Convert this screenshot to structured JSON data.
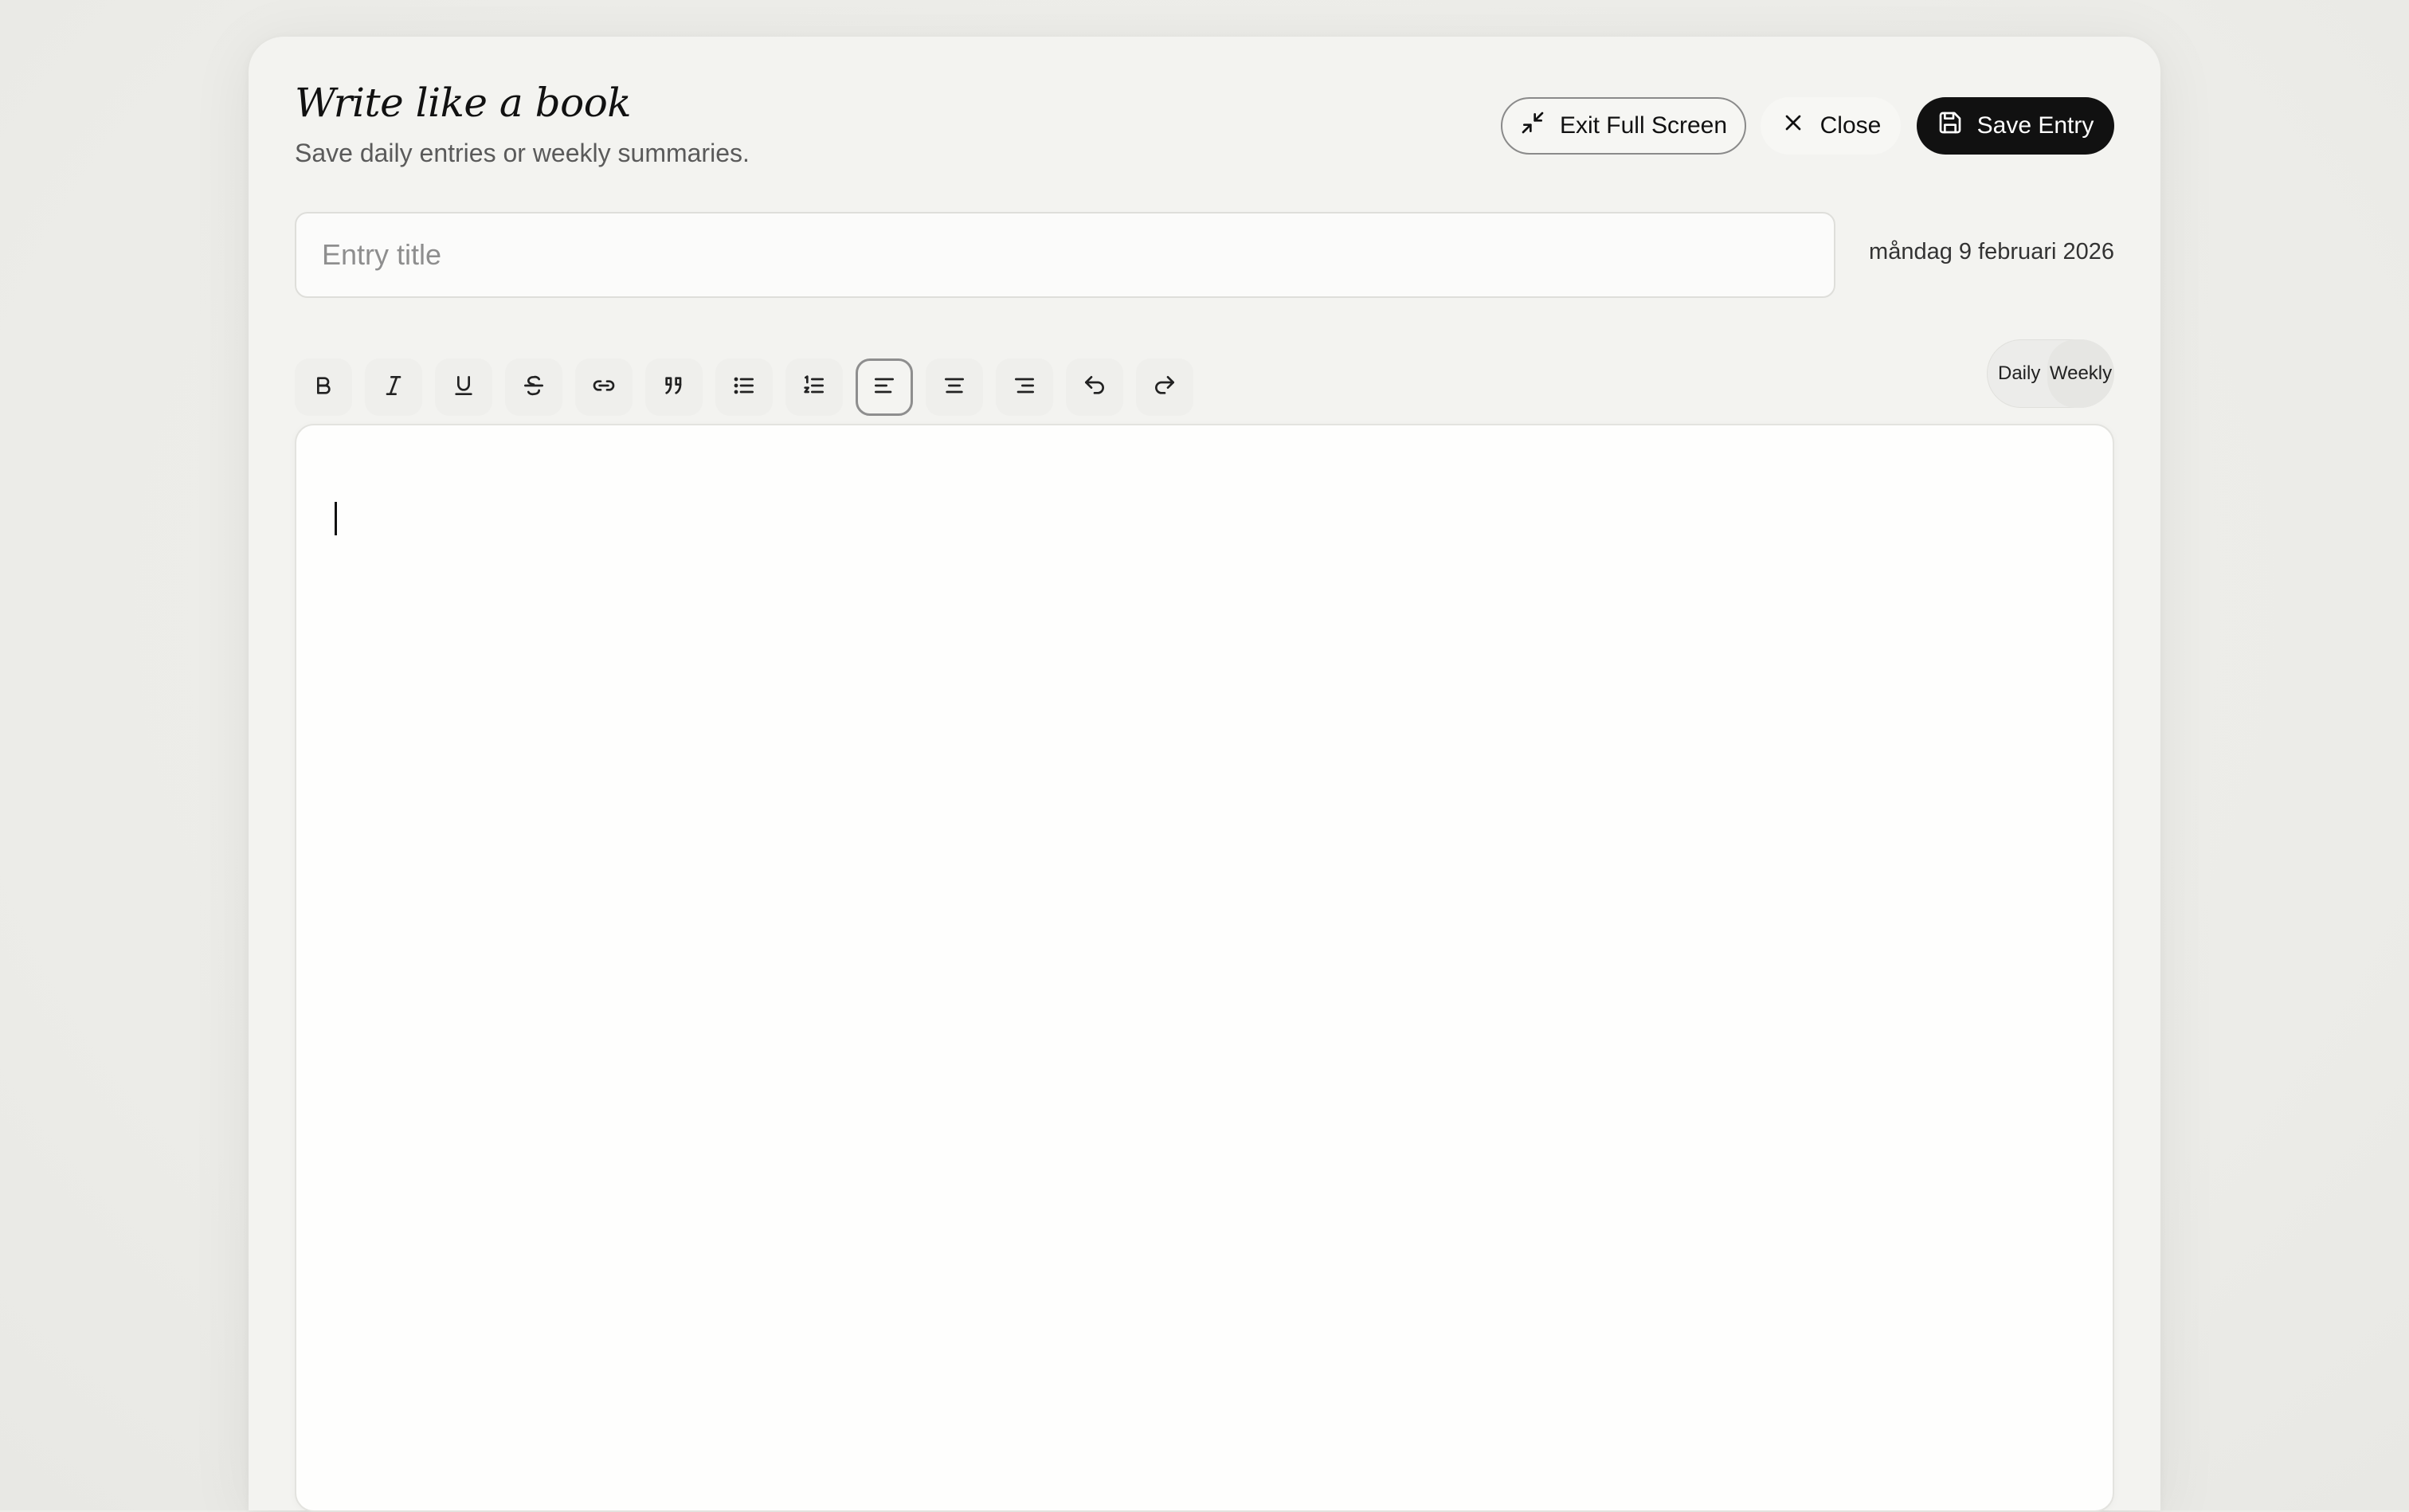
{
  "header": {
    "title": "Write like a book",
    "subtitle": "Save daily entries or weekly summaries."
  },
  "actions": {
    "exit_fullscreen_label": "Exit Full Screen",
    "close_label": "Close",
    "save_label": "Save Entry"
  },
  "entry": {
    "title_placeholder": "Entry title",
    "title_value": "",
    "date": "måndag 9 februari 2026"
  },
  "toolbar": {
    "tools": [
      {
        "name": "bold",
        "icon": "bold-icon",
        "active": false
      },
      {
        "name": "italic",
        "icon": "italic-icon",
        "active": false
      },
      {
        "name": "underline",
        "icon": "underline-icon",
        "active": false
      },
      {
        "name": "strikethrough",
        "icon": "strikethrough-icon",
        "active": false
      },
      {
        "name": "link",
        "icon": "link-icon",
        "active": false
      },
      {
        "name": "blockquote",
        "icon": "quote-icon",
        "active": false
      },
      {
        "name": "bullet-list",
        "icon": "bullet-list-icon",
        "active": false
      },
      {
        "name": "numbered-list",
        "icon": "numbered-list-icon",
        "active": false
      },
      {
        "name": "align-left",
        "icon": "align-left-icon",
        "active": true
      },
      {
        "name": "align-center",
        "icon": "align-center-icon",
        "active": false
      },
      {
        "name": "align-right",
        "icon": "align-right-icon",
        "active": false
      },
      {
        "name": "undo",
        "icon": "undo-icon",
        "active": false
      },
      {
        "name": "redo",
        "icon": "redo-icon",
        "active": false
      }
    ]
  },
  "mode": {
    "daily_label": "Daily",
    "weekly_label": "Weekly",
    "selected": "Weekly"
  },
  "editor": {
    "content": ""
  },
  "colors": {
    "primary_button": "#111111",
    "background": "#eeeeea",
    "panel": "#f3f3f0",
    "editor": "#fefefd"
  }
}
